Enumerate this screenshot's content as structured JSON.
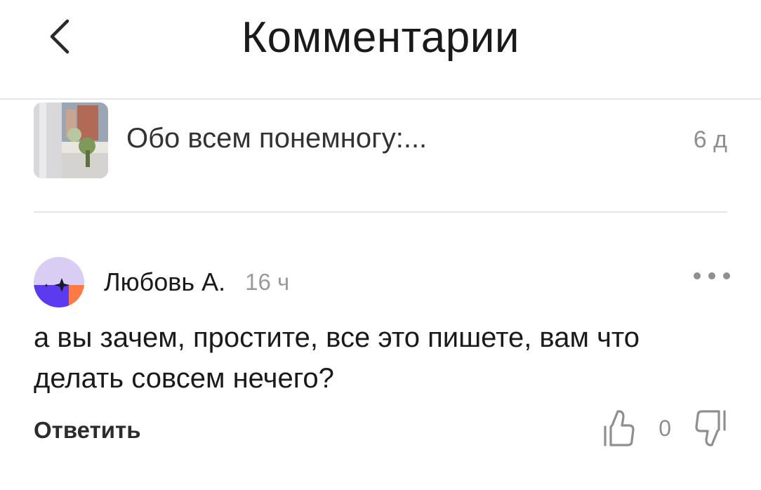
{
  "header": {
    "title": "Комментарии",
    "back_icon": "chevron-left-icon"
  },
  "post": {
    "title": "Обо всем понемногу:...",
    "age": "6 д"
  },
  "comment": {
    "author": "Любовь А.",
    "time": "16 ч",
    "text": "а вы зачем, простите, все это пишете, вам что делать совсем нечего?",
    "reply_label": "Ответить",
    "likes": "0",
    "avatar_colors": [
      "#d9cdf4",
      "#5b3af0",
      "#ff7a45"
    ]
  }
}
